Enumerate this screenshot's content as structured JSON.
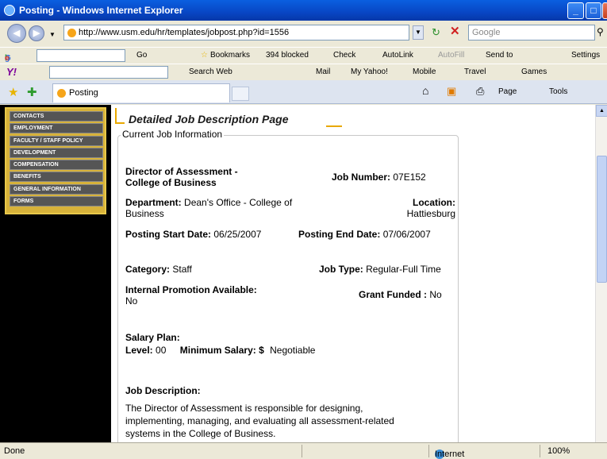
{
  "window": {
    "title": "Posting - Windows Internet Explorer",
    "min": "_",
    "max": "□",
    "close": "X"
  },
  "address": {
    "url": "http://www.usm.edu/hr/templates/jobpost.php?id=1556",
    "search_placeholder": "Google"
  },
  "toolbar1": {
    "google": "Google",
    "go": "Go",
    "bookmarks": "Bookmarks",
    "blocked": "394 blocked",
    "check": "Check",
    "autolink": "AutoLink",
    "autofill": "AutoFill",
    "sendto": "Send to",
    "settings": "Settings"
  },
  "toolbar2": {
    "yahoo": "Y!",
    "search_web": "Search Web",
    "mail": "Mail",
    "myyahoo": "My Yahoo!",
    "mobile": "Mobile",
    "travel": "Travel",
    "games": "Games"
  },
  "tabs": {
    "active": "Posting"
  },
  "commands": {
    "page": "Page",
    "tools": "Tools"
  },
  "leftnav": {
    "items": [
      "CONTACTS",
      "EMPLOYMENT",
      "FACULTY / STAFF POLICY",
      "DEVELOPMENT",
      "COMPENSATION",
      "BENEFITS",
      "GENERAL INFORMATION",
      "FORMS"
    ]
  },
  "page": {
    "heading": "Detailed Job Description Page",
    "legend": "Current Job Information",
    "title_line1": "Director of Assessment -",
    "title_line2": "College of Business",
    "job_number_label": "Job Number:",
    "job_number": "07E152",
    "department_label": "Department:",
    "department_line1": "Dean's Office - College of",
    "department_line2": "Business",
    "location_label": "Location:",
    "location": "Hattiesburg",
    "posting_start_label": "Posting Start Date:",
    "posting_start": "06/25/2007",
    "posting_end_label": "Posting End Date:",
    "posting_end": "07/06/2007",
    "category_label": "Category:",
    "category": "Staff",
    "job_type_label": "Job Type:",
    "job_type": "Regular-Full Time",
    "internal_promo_label": "Internal Promotion Available:",
    "internal_promo": "No",
    "grant_funded_label": "Grant Funded :",
    "grant_funded": "No",
    "salary_plan_label": "Salary Plan:",
    "level_label": "Level:",
    "level": "00",
    "min_salary_label": "Minimum Salary: $",
    "min_salary": "Negotiable",
    "job_desc_label": "Job Description:",
    "job_desc_line1": "The Director of Assessment is responsible for designing,",
    "job_desc_line2": "implementing, managing, and evaluating all assessment-related",
    "job_desc_line3": "systems in the College of Business."
  },
  "status": {
    "text": "Done",
    "zone": "Internet",
    "zoom": "100%"
  }
}
